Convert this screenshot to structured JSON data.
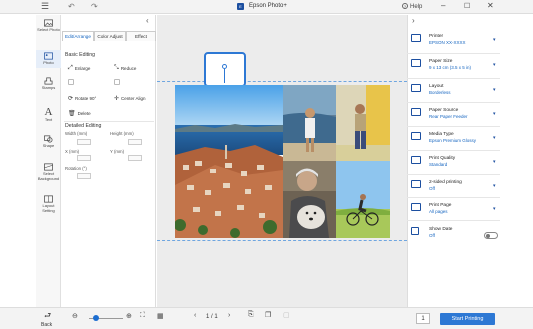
{
  "app": {
    "title": "Epson Photo+",
    "icon_text": "E",
    "help_label": "Help"
  },
  "rail": [
    {
      "label": "Select Photo",
      "icon": "photo-select-icon"
    },
    {
      "label": "Photo",
      "icon": "photo-icon",
      "active": true
    },
    {
      "label": "Stamps",
      "icon": "stamp-icon"
    },
    {
      "label": "Text",
      "icon": "text-icon",
      "glyph": "A"
    },
    {
      "label": "Shape",
      "icon": "shape-icon"
    },
    {
      "label": "Select Background",
      "icon": "background-icon"
    },
    {
      "label": "Layout Setting",
      "icon": "layout-icon"
    }
  ],
  "panel": {
    "tabs": [
      "Edit/Arrange",
      "Color Adjust",
      "Effect"
    ],
    "basic_title": "Basic Editing",
    "tools": {
      "enlarge": "Enlarge",
      "reduce": "Reduce",
      "rotate": "Rotate 90°",
      "center_align": "Center Align",
      "delete": "Delete"
    },
    "detailed_title": "Detailed Editing",
    "fields": {
      "width": "Width (mm)",
      "height": "Height (mm)",
      "x": "X (mm)",
      "y": "Y (mm)",
      "rotation": "Rotation (°)"
    }
  },
  "settings": [
    {
      "label": "Printer",
      "value": "EPSON XX-XXXX",
      "icon": "printer-icon"
    },
    {
      "label": "Paper Size",
      "value": "9 x 13 cm (3.5 x 5 in)",
      "icon": "paper-size-icon"
    },
    {
      "label": "Layout",
      "value": "Borderless",
      "icon": "layout-icon"
    },
    {
      "label": "Paper Source",
      "value": "Rear Paper Feeder",
      "icon": "paper-source-icon"
    },
    {
      "label": "Media Type",
      "value": "Epson Premium Glossy",
      "icon": "media-type-icon"
    },
    {
      "label": "Print Quality",
      "value": "Standard",
      "icon": "print-quality-icon"
    },
    {
      "label": "2-sided printing",
      "value": "Off",
      "icon": "two-sided-icon"
    },
    {
      "label": "Print Page",
      "value": "All pages",
      "icon": "print-page-icon"
    }
  ],
  "show_date": {
    "label": "Show Date",
    "value": "Off"
  },
  "bottom": {
    "back_label": "Back",
    "page_indicator": "1 / 1",
    "copies": "1",
    "start_label": "Start Printing"
  },
  "colors": {
    "accent": "#2d78d4",
    "brand": "#1c4fa0"
  }
}
